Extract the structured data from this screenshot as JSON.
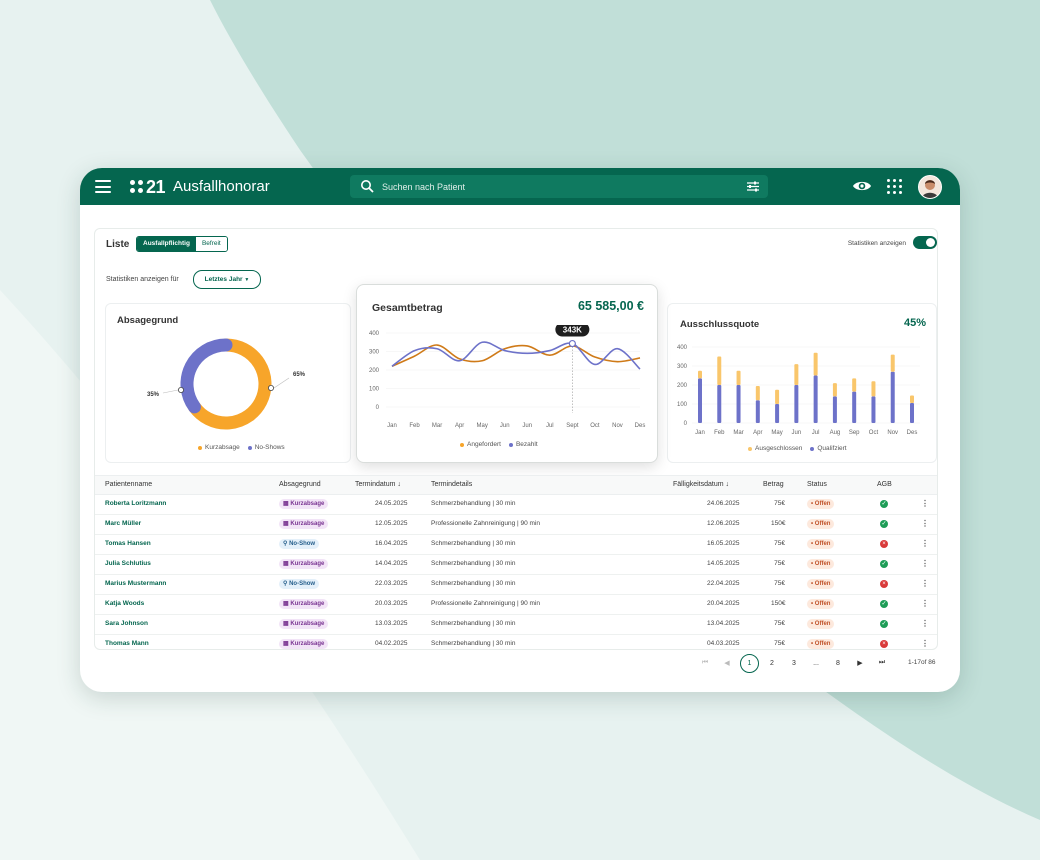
{
  "app": {
    "logo_number": "21",
    "title": "Ausfallhonorar"
  },
  "search": {
    "placeholder": "Suchen nach Patient"
  },
  "toolbar": {
    "liste_label": "Liste",
    "segments": [
      "Ausfallpflichtig",
      "Befreit"
    ],
    "stats_toggle_label": "Statistiken anzeigen",
    "stats_toggle_on": true,
    "stats_for_label": "Statistiken anzeigen für",
    "period": "Letztes Jahr"
  },
  "colors": {
    "brand": "#05664f",
    "orange": "#f7a52a",
    "purple": "#6d72c9"
  },
  "cards": {
    "reasons": {
      "title": "Absagegrund",
      "legend": [
        "Kurzabsage",
        "No-Shows"
      ]
    },
    "total": {
      "title": "Gesamtbetrag",
      "value": "65 585,00 €",
      "tooltip": "343K",
      "legend": [
        "Angefordert",
        "Bezahlt"
      ]
    },
    "exclusion": {
      "title": "Ausschlussquote",
      "value": "45%",
      "legend": [
        "Ausgeschlossen",
        "Qualifziert"
      ]
    }
  },
  "chart_data": [
    {
      "type": "pie",
      "title": "Absagegrund",
      "labels": [
        "Kurzabsage",
        "No-Shows"
      ],
      "values": [
        65,
        35
      ],
      "data_labels": [
        "65%",
        "35%"
      ],
      "legend": "bottom"
    },
    {
      "type": "line",
      "title": "Gesamtbetrag",
      "categories": [
        "Jan",
        "Feb",
        "Mar",
        "Apr",
        "May",
        "Jun",
        "Jun",
        "Jul",
        "Sept",
        "Oct",
        "Nov",
        "Des"
      ],
      "series": [
        {
          "name": "Angefordert",
          "values": [
            220,
            275,
            335,
            260,
            250,
            315,
            330,
            280,
            330,
            270,
            245,
            265
          ]
        },
        {
          "name": "Bezahlt",
          "values": [
            220,
            305,
            315,
            250,
            350,
            305,
            290,
            305,
            343,
            230,
            315,
            205
          ]
        }
      ],
      "yticks": [
        0,
        100,
        200,
        300,
        400
      ],
      "ylim": [
        0,
        400
      ],
      "annotation": {
        "category_index": 8,
        "label": "343K"
      },
      "legend": "bottom"
    },
    {
      "type": "bar",
      "title": "Ausschlussquote",
      "categories": [
        "Jan",
        "Feb",
        "Mar",
        "Apr",
        "May",
        "Jun",
        "Jul",
        "Aug",
        "Sep",
        "Oct",
        "Nov",
        "Des"
      ],
      "series": [
        {
          "name": "Ausgeschlossen",
          "values": [
            40,
            150,
            75,
            75,
            75,
            110,
            120,
            70,
            70,
            80,
            90,
            40
          ]
        },
        {
          "name": "Qualifziert",
          "values": [
            235,
            200,
            200,
            120,
            100,
            200,
            250,
            140,
            165,
            140,
            270,
            105
          ]
        }
      ],
      "stacked": true,
      "yticks": [
        0,
        100,
        200,
        300,
        400
      ],
      "ylim": [
        0,
        400
      ],
      "legend": "bottom"
    }
  ],
  "table": {
    "headers": {
      "name": "Patientenname",
      "reason": "Absagegrund",
      "date": "Termindatum",
      "details": "Termindetails",
      "due": "Fälligkeitsdatum",
      "amount": "Betrag",
      "status": "Status",
      "agb": "AGB"
    },
    "rows": [
      {
        "name": "Roberta Loritzmann",
        "reason": "Kurzabsage",
        "date": "24.05.2025",
        "details": "Schmerzbehandlung | 30 min",
        "due": "24.06.2025",
        "amount": "75€",
        "status": "Offen",
        "agb": "ok"
      },
      {
        "name": "Marc Müller",
        "reason": "Kurzabsage",
        "date": "12.05.2025",
        "details": "Professionelle Zahnreinigung | 90 min",
        "due": "12.06.2025",
        "amount": "150€",
        "status": "Offen",
        "agb": "ok"
      },
      {
        "name": "Tomas Hansen",
        "reason": "No-Show",
        "date": "16.04.2025",
        "details": "Schmerzbehandlung | 30 min",
        "due": "16.05.2025",
        "amount": "75€",
        "status": "Offen",
        "agb": "no"
      },
      {
        "name": "Julia Schlutius",
        "reason": "Kurzabsage",
        "date": "14.04.2025",
        "details": "Schmerzbehandlung | 30 min",
        "due": "14.05.2025",
        "amount": "75€",
        "status": "Offen",
        "agb": "ok"
      },
      {
        "name": "Marius Mustermann",
        "reason": "No-Show",
        "date": "22.03.2025",
        "details": "Schmerzbehandlung | 30 min",
        "due": "22.04.2025",
        "amount": "75€",
        "status": "Offen",
        "agb": "no"
      },
      {
        "name": "Katja Woods",
        "reason": "Kurzabsage",
        "date": "20.03.2025",
        "details": "Professionelle Zahnreinigung | 90 min",
        "due": "20.04.2025",
        "amount": "150€",
        "status": "Offen",
        "agb": "ok"
      },
      {
        "name": "Sara Johnson",
        "reason": "Kurzabsage",
        "date": "13.03.2025",
        "details": "Schmerzbehandlung | 30 min",
        "due": "13.04.2025",
        "amount": "75€",
        "status": "Offen",
        "agb": "ok"
      },
      {
        "name": "Thomas Mann",
        "reason": "Kurzabsage",
        "date": "04.02.2025",
        "details": "Schmerzbehandlung | 30 min",
        "due": "04.03.2025",
        "amount": "75€",
        "status": "Offen",
        "agb": "no"
      }
    ]
  },
  "pagination": {
    "pages": [
      "1",
      "2",
      "3",
      "...",
      "8"
    ],
    "current": "1",
    "range": "1-17of 86"
  }
}
